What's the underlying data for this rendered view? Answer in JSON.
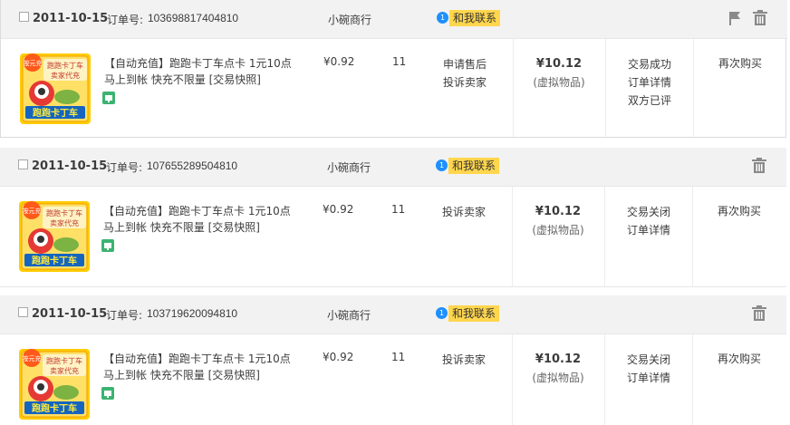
{
  "orders": [
    {
      "date": "2011-10-15",
      "order_no_label": "订单号:",
      "order_no": "103698817404810",
      "shop": "小碗商行",
      "contact": "和我联系",
      "item_title": "【自动充值】跑跑卡丁车点卡 1元10点 马上到帐 快充不限量 [交易快照]",
      "price": "¥0.92",
      "qty": "11",
      "service": [
        "申请售后",
        "投诉卖家"
      ],
      "total": "¥10.12",
      "total_note": "(虚拟物品)",
      "status": [
        "交易成功",
        "订单详情",
        "双方已评"
      ],
      "rebuy": "再次购买",
      "has_flag": true
    },
    {
      "date": "2011-10-15",
      "order_no_label": "订单号:",
      "order_no": "107655289504810",
      "shop": "小碗商行",
      "contact": "和我联系",
      "item_title": "【自动充值】跑跑卡丁车点卡 1元10点 马上到帐 快充不限量 [交易快照]",
      "price": "¥0.92",
      "qty": "11",
      "service": [
        "投诉卖家"
      ],
      "total": "¥10.12",
      "total_note": "(虚拟物品)",
      "status": [
        "交易关闭",
        "订单详情"
      ],
      "rebuy": "再次购买",
      "has_flag": false
    },
    {
      "date": "2011-10-15",
      "order_no_label": "订单号:",
      "order_no": "103719620094810",
      "shop": "小碗商行",
      "contact": "和我联系",
      "item_title": "【自动充值】跑跑卡丁车点卡 1元10点 马上到帐 快充不限量 [交易快照]",
      "price": "¥0.92",
      "qty": "11",
      "service": [
        "投诉卖家"
      ],
      "total": "¥10.12",
      "total_note": "(虚拟物品)",
      "status": [
        "交易关闭",
        "订单详情"
      ],
      "rebuy": "再次购买",
      "has_flag": false
    }
  ],
  "thumb": {
    "badge": "按元充",
    "top_text": "跑跑卡丁车",
    "mid_text": "卖家代充",
    "logo": "跑跑卡丁车"
  },
  "icons": {
    "checkbox": "checkbox",
    "contact": "chat-bubble-icon",
    "flag": "flag-icon",
    "trash": "trash-icon",
    "snapshot": "snapshot-icon"
  },
  "colors": {
    "header_bg": "#f2f2f2",
    "contact_bg": "#ffd64d",
    "contact_dot": "#1e90ff",
    "thumb_bg": "#ffcc00",
    "snapshot": "#3cb371"
  }
}
